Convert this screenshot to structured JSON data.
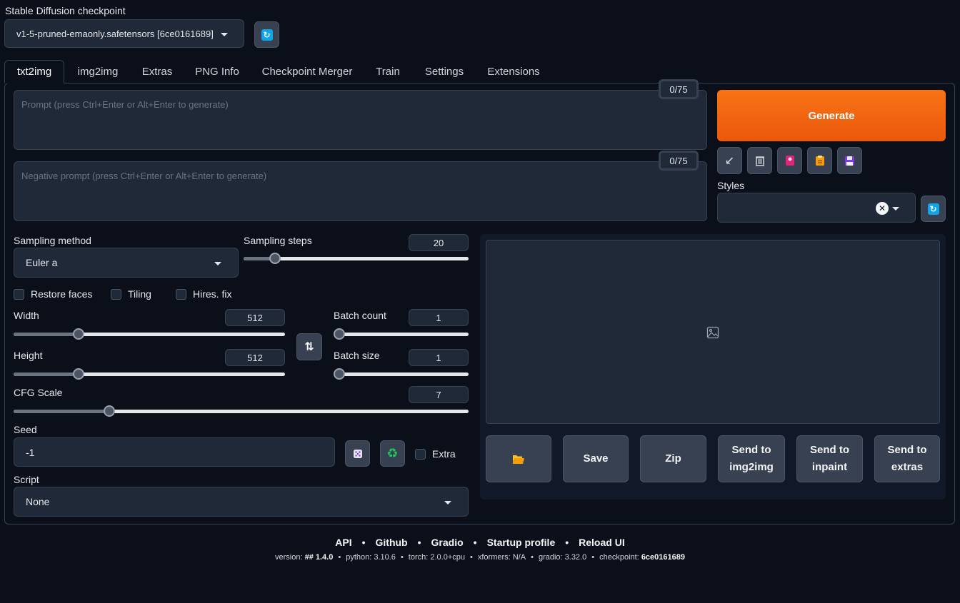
{
  "checkpoint": {
    "label": "Stable Diffusion checkpoint",
    "value": "v1-5-pruned-emaonly.safetensors [6ce0161689]"
  },
  "tabs": [
    {
      "label": "txt2img",
      "active": true
    },
    {
      "label": "img2img"
    },
    {
      "label": "Extras"
    },
    {
      "label": "PNG Info"
    },
    {
      "label": "Checkpoint Merger"
    },
    {
      "label": "Train"
    },
    {
      "label": "Settings"
    },
    {
      "label": "Extensions"
    }
  ],
  "prompt": {
    "placeholder": "Prompt (press Ctrl+Enter or Alt+Enter to generate)",
    "counter": "0/75"
  },
  "negative_prompt": {
    "placeholder": "Negative prompt (press Ctrl+Enter or Alt+Enter to generate)",
    "counter": "0/75"
  },
  "generate_label": "Generate",
  "toolbar_icons": [
    "arrow-icon",
    "trash-icon",
    "card-icon",
    "clipboard-icon",
    "floppy-icon"
  ],
  "styles": {
    "label": "Styles",
    "value": ""
  },
  "sampling": {
    "method_label": "Sampling method",
    "method_value": "Euler a",
    "steps_label": "Sampling steps",
    "steps_value": "20",
    "steps_fraction": 0.14
  },
  "checkboxes": {
    "restore_faces": "Restore faces",
    "tiling": "Tiling",
    "hires_fix": "Hires. fix",
    "extra": "Extra"
  },
  "width": {
    "label": "Width",
    "value": "512",
    "fraction": 0.24
  },
  "height": {
    "label": "Height",
    "value": "512",
    "fraction": 0.24
  },
  "batch_count": {
    "label": "Batch count",
    "value": "1",
    "fraction": 0.0
  },
  "batch_size": {
    "label": "Batch size",
    "value": "1",
    "fraction": 0.0
  },
  "cfg": {
    "label": "CFG Scale",
    "value": "7",
    "fraction": 0.21
  },
  "seed": {
    "label": "Seed",
    "value": "-1"
  },
  "script": {
    "label": "Script",
    "value": "None"
  },
  "output_buttons": {
    "folder": "",
    "save": "Save",
    "zip": "Zip",
    "send_img2img": "Send to img2img",
    "send_inpaint": "Send to inpaint",
    "send_extras": "Send to extras"
  },
  "footer": {
    "links": [
      "API",
      "Github",
      "Gradio",
      "Startup profile",
      "Reload UI"
    ],
    "version_label": "version:",
    "version_value": "## 1.4.0",
    "python": "python: 3.10.6",
    "torch": "torch: 2.0.0+cpu",
    "xformers": "xformers: N/A",
    "gradio": "gradio: 3.32.0",
    "checkpoint_label": "checkpoint:",
    "checkpoint_value": "6ce0161689"
  },
  "colors": {
    "background": "#0b0f19",
    "generate": "#f97316",
    "accent_refresh": "#0ea5e9"
  }
}
